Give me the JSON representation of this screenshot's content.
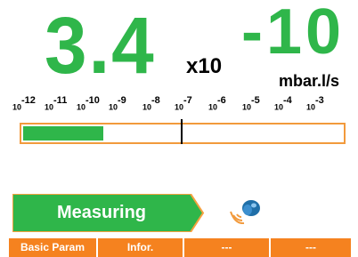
{
  "measurement": {
    "mantissa": "3.4",
    "multiplier": "x10",
    "exponent": "-10",
    "unit": "mbar.l/s"
  },
  "scale": {
    "base": "10",
    "exponents": [
      "-12",
      "-11",
      "-10",
      "-9",
      "-8",
      "-7",
      "-6",
      "-5",
      "-4",
      "-3"
    ]
  },
  "bar": {
    "fill_fraction": 0.25,
    "marker_fraction": 0.5
  },
  "status": {
    "label": "Measuring",
    "color": "#2fb64a"
  },
  "speaker": {
    "icon": "speaker-icon",
    "color": "#1f6fa8"
  },
  "softkeys": [
    "Basic Param",
    "Infor.",
    "---",
    "---"
  ],
  "colors": {
    "accent_green": "#2fb64a",
    "softkey_orange": "#f5821f",
    "bar_border": "#f29a3c"
  }
}
